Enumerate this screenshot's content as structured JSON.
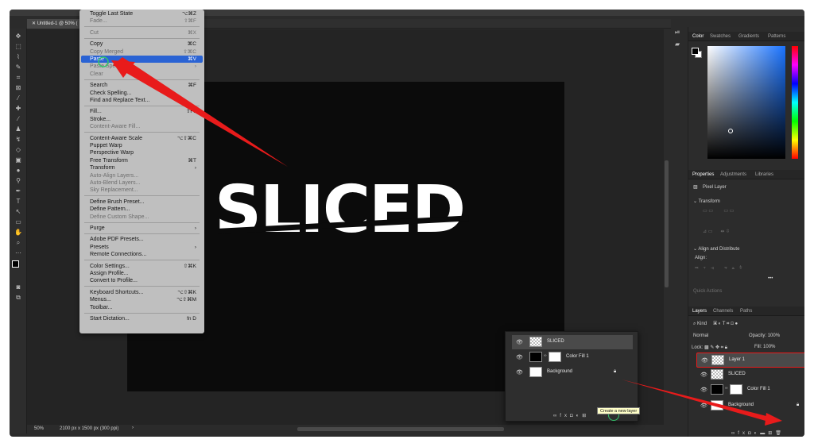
{
  "document": {
    "tab_title": "Untitled-1 @ 50% (",
    "canvas_text": "SLICED"
  },
  "status": {
    "zoom": "50%",
    "doc_info": "2100 px x 1500 px (300 ppi)",
    "arrow": "›"
  },
  "edit_menu": {
    "items": [
      {
        "label": "Toggle Last State",
        "shortcut": "⌥⌘Z",
        "disabled": false
      },
      {
        "label": "Fade...",
        "shortcut": "⇧⌘F",
        "disabled": true
      },
      {
        "label": "Cut",
        "shortcut": "⌘X",
        "disabled": true
      },
      {
        "label": "Copy",
        "shortcut": "⌘C",
        "disabled": false
      },
      {
        "label": "Copy Merged",
        "shortcut": "⇧⌘C",
        "disabled": true
      },
      {
        "label": "Paste",
        "shortcut": "⌘V",
        "disabled": false,
        "highlighted": true
      },
      {
        "label": "Paste Special",
        "shortcut": "›",
        "disabled": true
      },
      {
        "label": "Clear",
        "shortcut": "",
        "disabled": true
      },
      {
        "label": "Search",
        "shortcut": "⌘F",
        "disabled": false
      },
      {
        "label": "Check Spelling...",
        "shortcut": "",
        "disabled": false
      },
      {
        "label": "Find and Replace Text...",
        "shortcut": "",
        "disabled": false
      },
      {
        "label": "Fill...",
        "shortcut": "⇧F5",
        "disabled": false
      },
      {
        "label": "Stroke...",
        "shortcut": "",
        "disabled": false
      },
      {
        "label": "Content-Aware Fill...",
        "shortcut": "",
        "disabled": true
      },
      {
        "label": "Content-Aware Scale",
        "shortcut": "⌥⇧⌘C",
        "disabled": false
      },
      {
        "label": "Puppet Warp",
        "shortcut": "",
        "disabled": false
      },
      {
        "label": "Perspective Warp",
        "shortcut": "",
        "disabled": false
      },
      {
        "label": "Free Transform",
        "shortcut": "⌘T",
        "disabled": false
      },
      {
        "label": "Transform",
        "shortcut": "›",
        "disabled": false
      },
      {
        "label": "Auto-Align Layers...",
        "shortcut": "",
        "disabled": true
      },
      {
        "label": "Auto-Blend Layers...",
        "shortcut": "",
        "disabled": true
      },
      {
        "label": "Sky Replacement...",
        "shortcut": "",
        "disabled": true
      },
      {
        "label": "Define Brush Preset...",
        "shortcut": "",
        "disabled": false
      },
      {
        "label": "Define Pattern...",
        "shortcut": "",
        "disabled": false
      },
      {
        "label": "Define Custom Shape...",
        "shortcut": "",
        "disabled": true
      },
      {
        "label": "Purge",
        "shortcut": "›",
        "disabled": false
      },
      {
        "label": "Adobe PDF Presets...",
        "shortcut": "",
        "disabled": false
      },
      {
        "label": "Presets",
        "shortcut": "›",
        "disabled": false
      },
      {
        "label": "Remote Connections...",
        "shortcut": "",
        "disabled": false
      },
      {
        "label": "Color Settings...",
        "shortcut": "⇧⌘K",
        "disabled": false
      },
      {
        "label": "Assign Profile...",
        "shortcut": "",
        "disabled": false
      },
      {
        "label": "Convert to Profile...",
        "shortcut": "",
        "disabled": false
      },
      {
        "label": "Keyboard Shortcuts...",
        "shortcut": "⌥⇧⌘K",
        "disabled": false
      },
      {
        "label": "Menus...",
        "shortcut": "⌥⇧⌘M",
        "disabled": false
      },
      {
        "label": "Toolbar...",
        "shortcut": "",
        "disabled": false
      },
      {
        "label": "Start Dictation...",
        "shortcut": "fn D",
        "disabled": false
      }
    ]
  },
  "color_panel": {
    "tabs": [
      "Color",
      "Swatches",
      "Gradients",
      "Patterns"
    ]
  },
  "properties_panel": {
    "tabs": [
      "Properties",
      "Adjustments",
      "Libraries"
    ],
    "layer_type": "Pixel Layer",
    "transform_label": "Transform",
    "align_label": "Align and Distribute",
    "align_sub": "Align:",
    "quick_actions": "Quick Actions"
  },
  "layers_panel": {
    "tabs": [
      "Layers",
      "Channels",
      "Paths"
    ],
    "filter_kind": "Kind",
    "blend_mode": "Normal",
    "opacity_label": "Opacity:",
    "opacity_value": "100%",
    "lock_label": "Lock:",
    "fill_label": "Fill:",
    "fill_value": "100%",
    "layers": [
      {
        "name": "Layer 1",
        "thumb": "checker",
        "selected": true
      },
      {
        "name": "SLICED",
        "thumb": "checker",
        "selected": false
      },
      {
        "name": "Color Fill 1",
        "thumb": "fill",
        "selected": false
      },
      {
        "name": "Background",
        "thumb": "white",
        "selected": false,
        "locked": true
      }
    ]
  },
  "zoom_popup": {
    "layers": [
      {
        "name": "SLICED"
      },
      {
        "name": "Color Fill 1"
      },
      {
        "name": "Background"
      }
    ],
    "tooltip": "Create a new layer"
  },
  "colors": {
    "highlight": "#2a63d4",
    "annotation": "#e81b1b",
    "ring": "#34c26a"
  }
}
